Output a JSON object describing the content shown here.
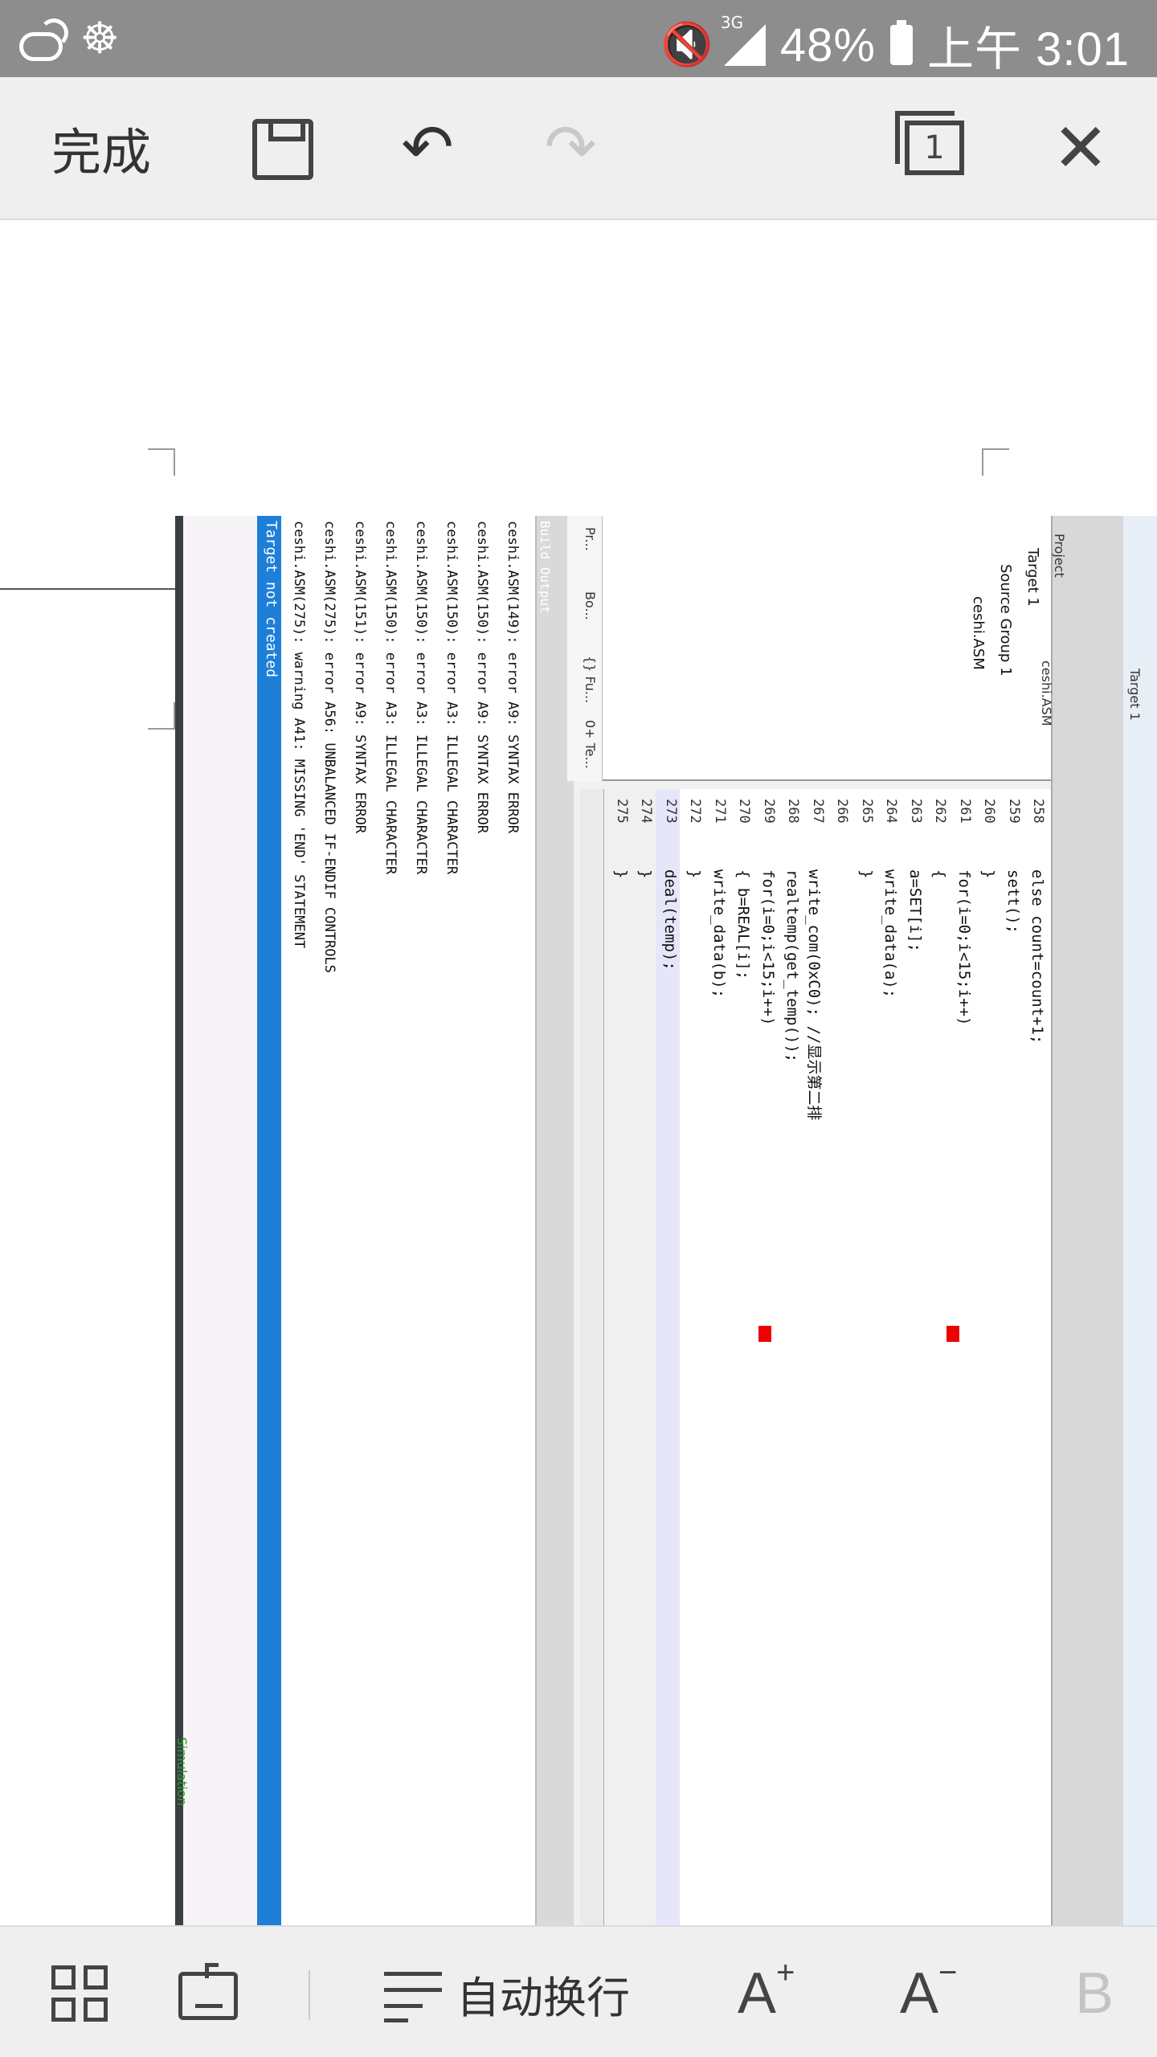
{
  "status_bar": {
    "network_type": "3G",
    "battery": "48%",
    "time": "上午 3:01",
    "icons": [
      "weather-cloud-icon",
      "uc-browser-icon",
      "mute-icon",
      "signal-icon",
      "battery-icon"
    ]
  },
  "toolbar": {
    "done_label": "完成",
    "page_count": "1",
    "icons": [
      "save-icon",
      "undo-icon",
      "redo-icon",
      "pages-icon",
      "close-icon"
    ]
  },
  "screenshot": {
    "simulation_label": "Simulation",
    "build_output_title": "Build Output",
    "build_lines": [
      "ceshi.ASM(149): error A9: SYNTAX ERROR",
      "ceshi.ASM(150): error A9: SYNTAX ERROR",
      "ceshi.ASM(150): error A3: ILLEGAL CHARACTER",
      "ceshi.ASM(150): error A3: ILLEGAL CHARACTER",
      "ceshi.ASM(150): error A3: ILLEGAL CHARACTER",
      "ceshi.ASM(151): error A9: SYNTAX ERROR",
      "ceshi.ASM(275): error A56: UNBALANCED IF-ENDIF CONTROLS",
      "ceshi.ASM(275): warning A41: MISSING 'END' STATEMENT"
    ],
    "build_status": "Target not created",
    "project_tabs": [
      "Pr...",
      "Bo...",
      "{} Fu...",
      "0+ Te..."
    ],
    "project_tree": [
      "Target 1",
      "Source Group 1",
      "ceshi.ASM"
    ],
    "project_title": "Project",
    "target_select": "Target 1",
    "editor_tab": "ceshi.ASM",
    "line_numbers": [
      "258",
      "259",
      "260",
      "261",
      "262",
      "263",
      "264",
      "265",
      "266",
      "267",
      "268",
      "269",
      "270",
      "271",
      "272",
      "273",
      "274",
      "275"
    ],
    "code_lines": [
      "            else count=count+1;",
      "        sett();",
      "      }",
      "    for(i=0;i<15;i++)",
      "    {",
      "        a=SET[i];",
      "        write_data(a);",
      "    }",
      "",
      "    write_com(0xC0);              //显示第二排",
      "    realtemp(get_temp());",
      "    for(i=0;i<15;i++)",
      "    {   b=REAL[i];",
      "        write_data(b);",
      "    }",
      "    deal(temp);",
      "  }",
      "}"
    ]
  },
  "bottom_bar": {
    "wrap_label": "自动换行",
    "increase_font": "A",
    "decrease_font": "A",
    "bold": "B",
    "icons": [
      "apps-grid-icon",
      "keyboard-icon",
      "word-wrap-icon",
      "font-increase-icon",
      "font-decrease-icon",
      "bold-icon"
    ]
  }
}
